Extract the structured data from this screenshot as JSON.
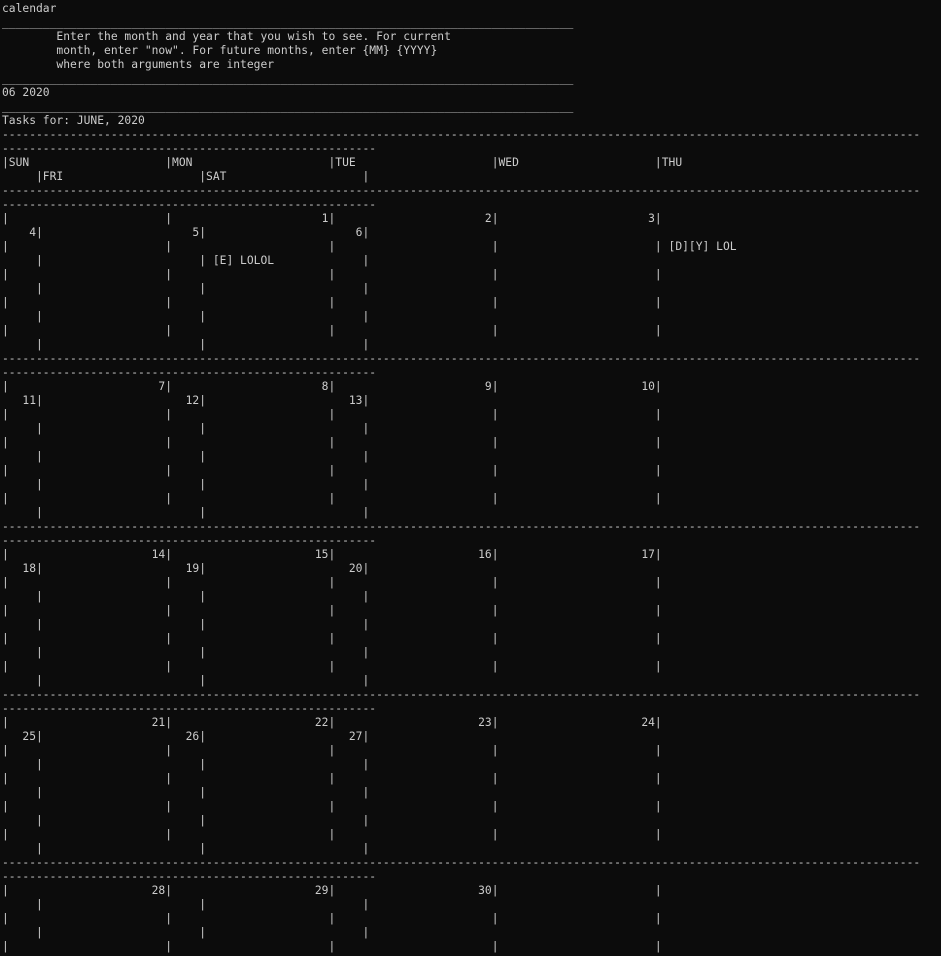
{
  "terminal": {
    "lines": [
      "calendar",
      "____________________________________________________________________________________",
      "        Enter the month and year that you wish to see. For current",
      "        month, enter \"now\". For future months, enter {MM} {YYYY}",
      "        where both arguments are integer",
      "____________________________________________________________________________________",
      "06 2020",
      "____________________________________________________________________________________",
      "Tasks for: JUNE, 2020",
      "---------------------------------------------------------------------------------------------------------------------------------------",
      "-------------------------------------------------------",
      "|SUN                    |MON                    |TUE                    |WED                    |THU",
      "     |FRI                    |SAT                    |",
      "---------------------------------------------------------------------------------------------------------------------------------------",
      "-------------------------------------------------------",
      "|                       |                      1|                      2|                      3|",
      "    4|                      5|                      6|",
      "|                       |                       |                       |                       | [D][Y] LOL",
      "     |                       | [E] LOLOL             |",
      "|                       |                       |                       |                       |",
      "     |                       |                       |",
      "|                       |                       |                       |                       |",
      "     |                       |                       |",
      "|                       |                       |                       |                       |",
      "     |                       |                       |",
      "---------------------------------------------------------------------------------------------------------------------------------------",
      "-------------------------------------------------------",
      "|                      7|                      8|                      9|                     10|",
      "   11|                     12|                     13|",
      "|                       |                       |                       |                       |",
      "     |                       |                       |",
      "|                       |                       |                       |                       |",
      "     |                       |                       |",
      "|                       |                       |                       |                       |",
      "     |                       |                       |",
      "|                       |                       |                       |                       |",
      "     |                       |                       |",
      "---------------------------------------------------------------------------------------------------------------------------------------",
      "-------------------------------------------------------",
      "|                     14|                     15|                     16|                     17|",
      "   18|                     19|                     20|",
      "|                       |                       |                       |                       |",
      "     |                       |                       |",
      "|                       |                       |                       |                       |",
      "     |                       |                       |",
      "|                       |                       |                       |                       |",
      "     |                       |                       |",
      "|                       |                       |                       |                       |",
      "     |                       |                       |",
      "---------------------------------------------------------------------------------------------------------------------------------------",
      "-------------------------------------------------------",
      "|                     21|                     22|                     23|                     24|",
      "   25|                     26|                     27|",
      "|                       |                       |                       |                       |",
      "     |                       |                       |",
      "|                       |                       |                       |                       |",
      "     |                       |                       |",
      "|                       |                       |                       |                       |",
      "     |                       |                       |",
      "|                       |                       |                       |                       |",
      "     |                       |                       |",
      "---------------------------------------------------------------------------------------------------------------------------------------",
      "-------------------------------------------------------",
      "|                     28|                     29|                     30|                       |",
      "     |                       |                       |",
      "|                       |                       |                       |                       |",
      "     |                       |                       |",
      "|                       |                       |                       |                       |"
    ]
  }
}
